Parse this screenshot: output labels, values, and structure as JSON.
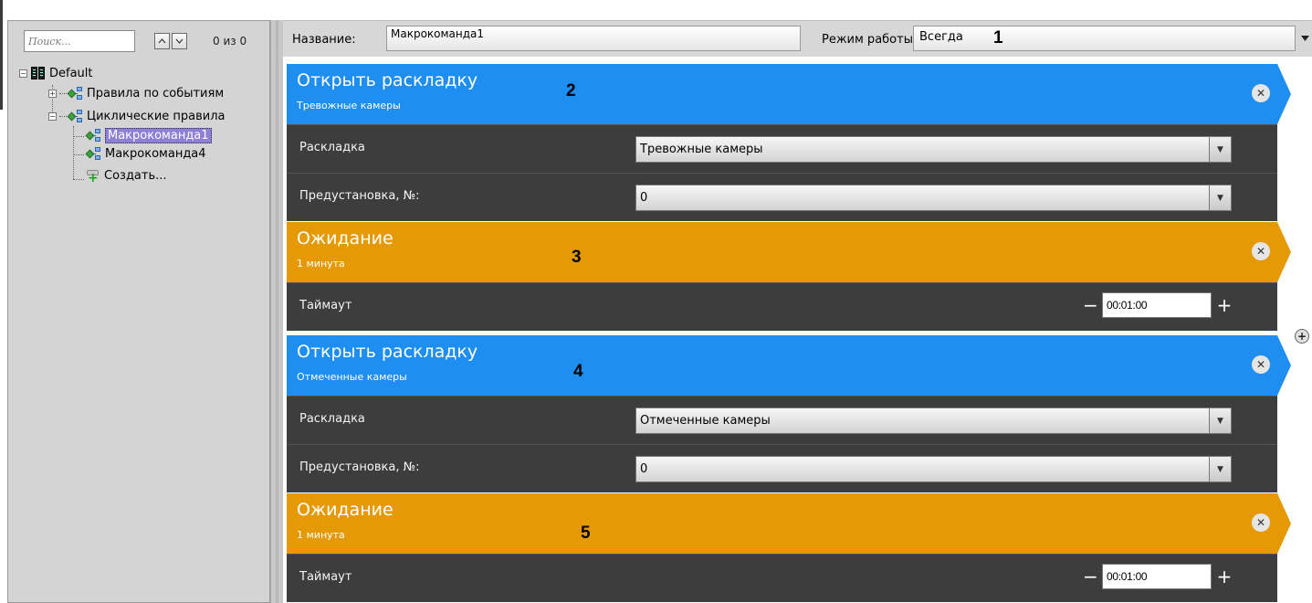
{
  "search": {
    "placeholder": "Поиск...",
    "prev_icon": "chevron-up-icon",
    "next_icon": "chevron-down-icon",
    "count": "0 из 0"
  },
  "tree": {
    "root": "Default",
    "event_rules": "Правила по событиям",
    "cyclic_rules": "Циклические правила",
    "macro1": "Макрокоманда1",
    "macro4": "Макрокоманда4",
    "create": "Создать..."
  },
  "header": {
    "name_label": "Название:",
    "name_value": "Макрокоманда1",
    "mode_label": "Режим работы",
    "mode_value": "Всегда"
  },
  "markers": [
    "1",
    "2",
    "3",
    "4",
    "5"
  ],
  "steps": [
    {
      "title": "Открыть раскладку",
      "subtitle": "Тревожные камеры",
      "color": "#1e8ef0",
      "params": [
        {
          "label": "Раскладка",
          "value": "Тревожные камеры"
        },
        {
          "label": "Предустановка, №:",
          "value": "0"
        }
      ]
    },
    {
      "title": "Ожидание",
      "subtitle": "1 минута",
      "color": "#e49905",
      "params": [
        {
          "label": "Таймаут",
          "value": "00:01:00"
        }
      ]
    },
    {
      "title": "Открыть раскладку",
      "subtitle": "Отмеченные камеры",
      "color": "#1e8ef0",
      "params": [
        {
          "label": "Раскладка",
          "value": "Отмеченные камеры"
        },
        {
          "label": "Предустановка, №:",
          "value": "0"
        }
      ]
    },
    {
      "title": "Ожидание",
      "subtitle": "1 минута",
      "color": "#e49905",
      "params": [
        {
          "label": "Таймаут",
          "value": "00:01:00"
        }
      ]
    }
  ],
  "icons": {
    "close": "close-circle-icon",
    "add": "plus-circle-icon",
    "dropdown": "triangle-down-icon",
    "minus": "minus-icon",
    "plus": "plus-icon"
  }
}
